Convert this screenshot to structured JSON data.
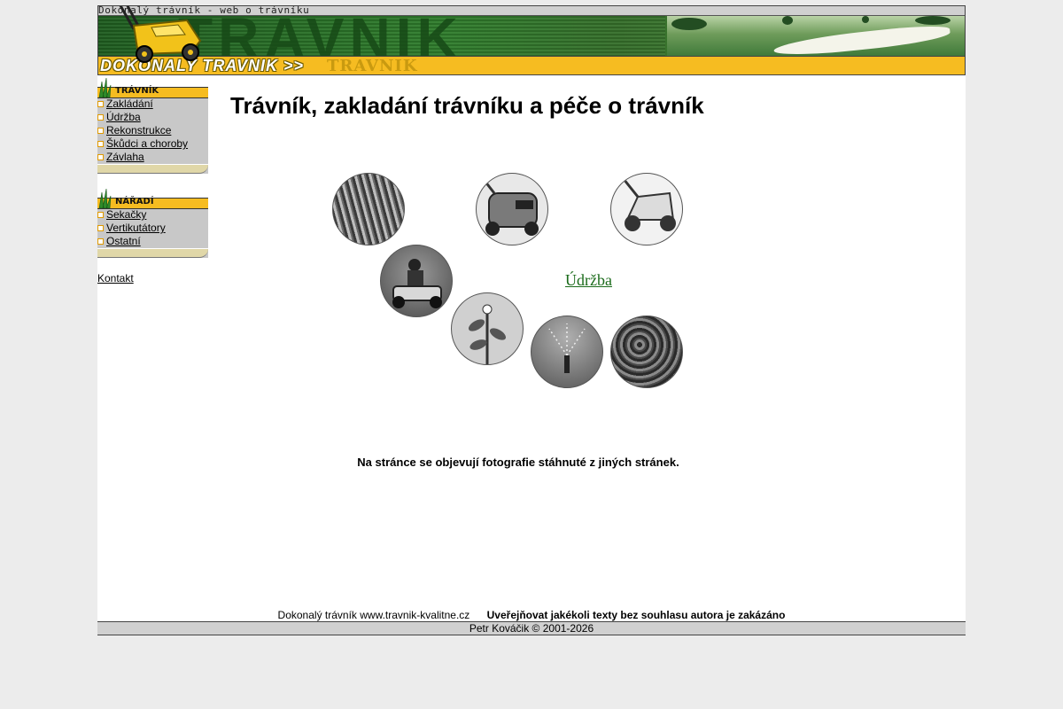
{
  "header": {
    "tagline": "Dokonalý trávník - web o trávníku",
    "banner_text": "TRAVNIK",
    "logo_text": "DOKONALY TRAVNIK >>",
    "logo_ghost": "TRAVNIK"
  },
  "sidebar": {
    "travnik": {
      "title": "TRÁVNÍK",
      "items": [
        "Zakládání",
        "Údržba",
        "Rekonstrukce",
        "Škůdci a choroby",
        "Závlaha"
      ]
    },
    "naradi": {
      "title": "NÁŘADÍ",
      "items": [
        "Sekačky",
        "Vertikutátory",
        "Ostatní"
      ]
    },
    "kontakt": "Kontakt"
  },
  "main": {
    "title": "Trávník, zakladání trávníku a péče o trávník",
    "circle_link": "Údržba",
    "notice": "Na stránce se objevují fotografie stáhnuté z jiných stránek.",
    "circles": [
      "grass-closeup",
      "lawn-mower",
      "scarifier",
      "riding-mower",
      "weed-plant",
      "sprinkler",
      "moss"
    ]
  },
  "footer": {
    "site": "Dokonalý trávník www.travnik-kvalitne.cz",
    "warning": "Uveřejňovat jakékoli texty bez souhlasu autora je zakázáno",
    "copyright": "Petr Kováčik © 2001-2026"
  },
  "colors": {
    "accent_yellow": "#f6bc21",
    "banner_green": "#2f7d2c",
    "link_green": "#1b6b1b",
    "sidebar_gray": "#c8c8c8",
    "page_bg": "#ececec"
  }
}
